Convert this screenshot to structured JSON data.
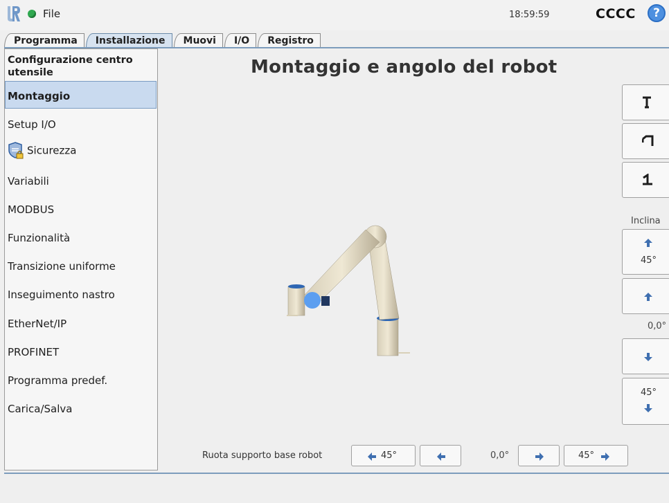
{
  "header": {
    "file_menu": "File",
    "clock": "18:59:59",
    "robot_name": "CCCC",
    "help": "?"
  },
  "tabs": [
    {
      "label": "Programma"
    },
    {
      "label": "Installazione"
    },
    {
      "label": "Muovi"
    },
    {
      "label": "I/O"
    },
    {
      "label": "Registro"
    }
  ],
  "sidebar": {
    "items": [
      {
        "label": "Configurazione centro utensile"
      },
      {
        "label": "Montaggio"
      },
      {
        "label": "Setup I/O"
      },
      {
        "label": "Sicurezza"
      },
      {
        "label": "Variabili"
      },
      {
        "label": "MODBUS"
      },
      {
        "label": "Funzionalità"
      },
      {
        "label": "Transizione uniforme"
      },
      {
        "label": "Inseguimento nastro"
      },
      {
        "label": "EtherNet/IP"
      },
      {
        "label": "PROFINET"
      },
      {
        "label": "Programma predef."
      },
      {
        "label": "Carica/Salva"
      }
    ]
  },
  "main": {
    "title": "Montaggio e angolo del robot",
    "tilt_label": "Inclina",
    "tilt_up_45": "45°",
    "tilt_down_45": "45°",
    "tilt_value": "0,0°",
    "rotate_label": "Ruota supporto base robot",
    "rotate_left_45": "45°",
    "rotate_right_45": "45°",
    "rotate_value": "0,0°"
  },
  "colors": {
    "accent": "#4d90e0",
    "selected": "#c9daef",
    "status_ok": "#2fa84f",
    "arrow": "#3f6fb0"
  }
}
